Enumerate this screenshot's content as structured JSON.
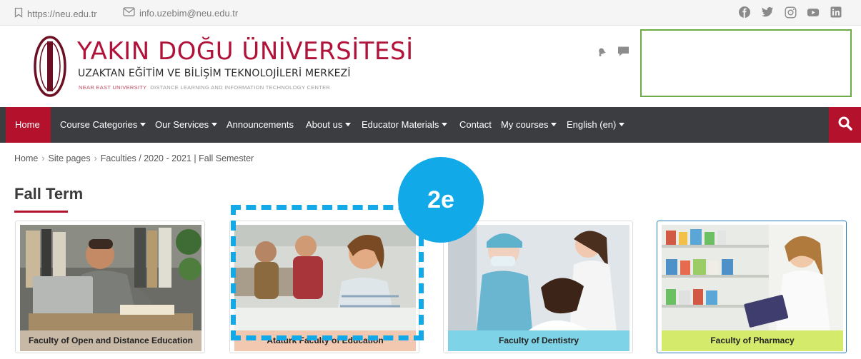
{
  "topbar": {
    "url_text": "https://neu.edu.tr",
    "email_text": "info.uzebim@neu.edu.tr",
    "url_icon": "bookmark-icon",
    "email_icon": "envelope-icon",
    "social": [
      "facebook-icon",
      "twitter-icon",
      "instagram-icon",
      "youtube-icon",
      "linkedin-icon"
    ]
  },
  "brand": {
    "title": "YAKIN DOĞU ÜNİVERSİTESİ",
    "subtitle": "UZAKTAN EĞİTİM VE BİLİŞİM TEKNOLOJİLERİ MERKEZİ",
    "tagline_red": "NEAR EAST UNIVERSITY",
    "tagline_gray": "DISTANCE LEARNING AND INFORMATION TECHNOLOGY CENTER",
    "accent_color": "#b0123a"
  },
  "header_icons": [
    "notification-bell-icon",
    "message-icon"
  ],
  "nav": {
    "home": "Home",
    "course_categories": "Course Categories",
    "our_services": "Our Services",
    "announcements": "Announcements",
    "about_us": "About us",
    "educator_materials": "Educator Materials",
    "contact": "Contact",
    "my_courses": "My courses",
    "language": "English (en)",
    "search_icon": "search-icon",
    "bar_color": "#3b3d40",
    "active_color": "#b4112d"
  },
  "breadcrumb": {
    "home": "Home",
    "site_pages": "Site pages",
    "current": "Faculties / 2020 - 2021 | Fall Semester"
  },
  "page": {
    "title": "Fall Term"
  },
  "cards": [
    {
      "caption": "Faculty of Open and Distance Education",
      "caption_color": "#c8b8a6"
    },
    {
      "caption": "Ataturk Faculty of Education",
      "caption_color": "#f2c9b0"
    },
    {
      "caption": "Faculty of Dentistry",
      "caption_color": "#7fd3e6"
    },
    {
      "caption": "Faculty of Pharmacy",
      "caption_color": "#d4ea6a"
    }
  ],
  "annotation": {
    "label": "2e",
    "color": "#12a9e8"
  }
}
